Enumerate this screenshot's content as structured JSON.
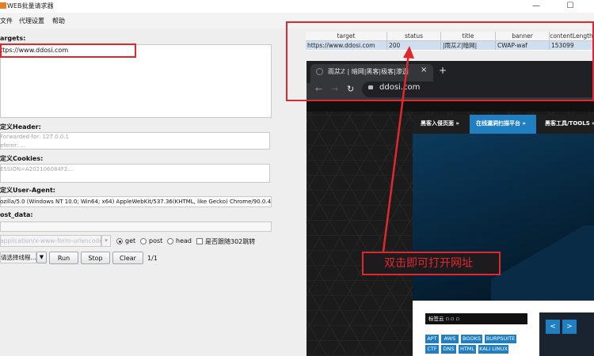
{
  "window": {
    "title": "WEB批量请求器",
    "minimize": "—",
    "maximize": "☐"
  },
  "menu": [
    "文件",
    "代理设置",
    "帮助"
  ],
  "form": {
    "targets_label": "argets:",
    "targets_value": "ttps://www.ddosi.com",
    "header_label": "定义Header:",
    "header_ph1": "Forwarded-for: 127.0.0.1",
    "header_ph2": "eferer: ...",
    "cookies_label": "定义Cookies:",
    "cookies_ph": "ESSION=A202106084F2...",
    "ua_label": "定义User-Agent:",
    "ua_value": "ozilla/5.0 (Windows NT 10.0; Win64; x64) AppleWebKit/537.36(KHTML, like Gecko) Chrome/90.0.44",
    "post_label": "ost_data:",
    "content_type": "application/x-www-form-urlencoded",
    "method_get": "get",
    "method_post": "post",
    "method_head": "head",
    "follow_302": "是否跟随302跳转",
    "thread_select": "请选择线程...",
    "run": "Run",
    "stop": "Stop",
    "clear": "Clear",
    "progress": "1/1"
  },
  "table": {
    "columns": [
      "target",
      "status",
      "title",
      "banner",
      "contentLength"
    ],
    "rows": [
      [
        "https://www.ddosi.com",
        "200",
        "|雨苁ℤ|暗网|",
        "CWAP-waf",
        "153099"
      ]
    ]
  },
  "browser": {
    "tab_title": "雨苁ℤ | 暗网|黑客|极客|渗透",
    "tab_close": "×",
    "new_tab": "+",
    "url": "ddosi.com",
    "nav": [
      "黑客入侵页面 »",
      "在线漏洞扫描平台 »",
      "黑客工具/TOOLS »"
    ],
    "tags_title": "标签云 ▫ ▫ ▫",
    "tags": [
      "APT",
      "AWS",
      "BOOKS",
      "BURPSUITE",
      "CTF",
      "DNS",
      "HTML",
      "KALI LINUX"
    ]
  },
  "annotation": {
    "callout": "双击即可打开网址"
  },
  "colors": {
    "highlight": "#e0282f",
    "selected_row": "#cfdff0",
    "nav_active": "#1f7fc0"
  }
}
